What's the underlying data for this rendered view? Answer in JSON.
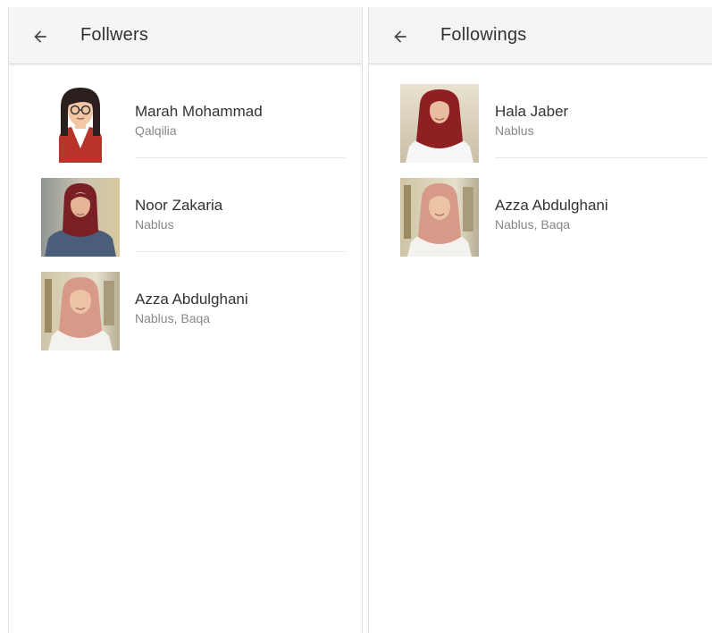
{
  "left_screen": {
    "title": "Follwers",
    "back_icon": "arrow-left-icon",
    "items": [
      {
        "name": "Marah Mohammad",
        "city": "Qalqilia",
        "avatar": "illustrated-avatar"
      },
      {
        "name": "Noor Zakaria",
        "city": "Nablus",
        "avatar": "photo-avatar"
      },
      {
        "name": "Azza Abdulghani",
        "city": "Nablus, Baqa",
        "avatar": "photo-avatar"
      }
    ]
  },
  "right_screen": {
    "title": "Followings",
    "back_icon": "arrow-left-icon",
    "items": [
      {
        "name": "Hala Jaber",
        "city": "Nablus",
        "avatar": "photo-avatar"
      },
      {
        "name": "Azza Abdulghani",
        "city": "Nablus, Baqa",
        "avatar": "photo-avatar"
      }
    ]
  },
  "colors": {
    "appbar_bg": "#f5f5f5",
    "text_primary": "#333333",
    "text_secondary": "#888888",
    "divider": "#e6e6e6"
  }
}
